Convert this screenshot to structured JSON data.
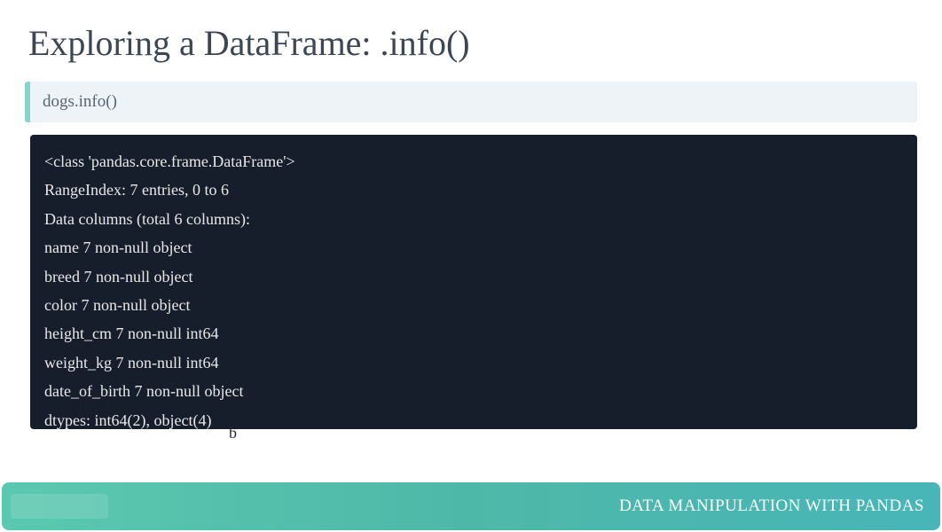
{
  "title": "Exploring a DataFrame: .info()",
  "code_input": "dogs.info()",
  "output_lines": {
    "l0": "<class 'pandas.core.frame.DataFrame'>",
    "l1": "RangeIndex: 7 entries, 0 to 6",
    "l2": "Data columns (total 6 columns):",
    "l3": "name 7 non-null object",
    "l4": "breed 7 non-null object",
    "l5": "color 7 non-null object",
    "l6": "height_cm 7 non-null int64",
    "l7": "weight_kg 7 non-null int64",
    "l8": "date_of_birth 7 non-null object",
    "l9": "dtypes: int64(2), object(4)"
  },
  "truncated_char": "b",
  "footer": {
    "course_label": "DATA MANIPULATION WITH PANDAS"
  }
}
